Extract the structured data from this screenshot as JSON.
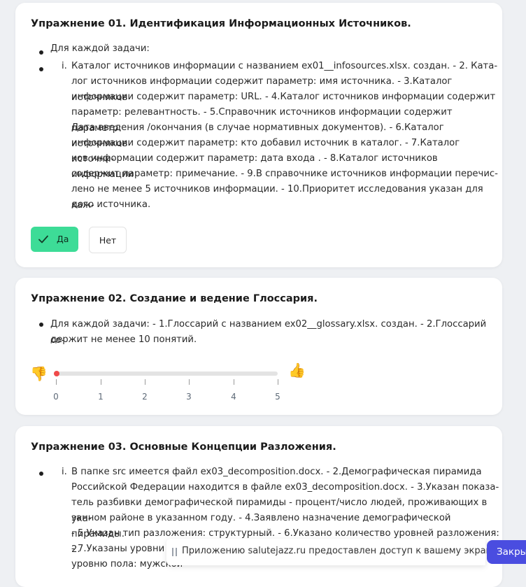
{
  "exercise1": {
    "title": "Упражнение 01. Идентификация Информационных Источников.",
    "bullet_text": "Для каждой задачи:",
    "roman": "i.",
    "lines": [
      "Каталог источников информации с названием ex01__infosources.xlsx. создан. - 2. Ката-",
      "лог источников информации содержит параметр: имя источника. - 3.Каталог источников",
      "информации содержит параметр: URL. - 4.Каталог источников информации содержит",
      "параметр: релевантность. - 5.Справочник источников информации содержит параметр:",
      "Дата введения /окончания (в случае нормативных документов). - 6.Каталог источников",
      "информации содержит параметр: кто добавил источник в каталог. - 7.Каталог источни-",
      "ков информации содержит параметр: дата входа . - 8.Каталог источников информации",
      "содержит параметр: примечание. - 9.В справочнике источников информации перечис-",
      "лено не менее 5 источников информации. - 10.Приоритет исследования указан для каж-",
      "дого источника."
    ],
    "yes_label": "Да",
    "no_label": "Нет"
  },
  "exercise2": {
    "title": "Упражнение 02. Создание и ведение Глоссария.",
    "lines": [
      "Для каждой задачи: - 1.Глоссарий с названием ex02__glossary.xlsx. создан. - 2.Глоссарий со-",
      "держит не менее 10 понятий."
    ],
    "thumbs_down_icon": "👎",
    "thumbs_up_icon": "👍",
    "scale_labels": [
      "0",
      "1",
      "2",
      "3",
      "4",
      "5"
    ],
    "rating_value": 0
  },
  "exercise3": {
    "title": "Упражнение 03. Основные Концепции Разложения.",
    "roman": "i.",
    "lines": [
      "В папке src имеется файл ex03_decomposition.docx. - 2.Демографическая пирамида",
      "Российской Федерации находится в файле ex03_decomposition.docx. - 3.Указан показа-",
      "тель разбивки демографической пирамиды - процент/число людей, проживающих в ука-",
      "занном районе в указанном году. - 4.Заявлено назначение демографической пирамиды.",
      "- 5.Указан тип разложения: структурный. - 6.Указано количество уровней разложения: 2.",
      "- 7.Указаны уровни разложения:",
      "уровню пола: мужской"
    ]
  },
  "toast": {
    "message": "Приложению salutejazz.ru предоставлен доступ к вашему экрану.",
    "close_label": "Закры"
  },
  "colors": {
    "yes_button": "#3ddc97",
    "slider_thumb": "#f04a4a",
    "toast_button": "#4a4de0",
    "page_bg": "#eef0f3"
  }
}
